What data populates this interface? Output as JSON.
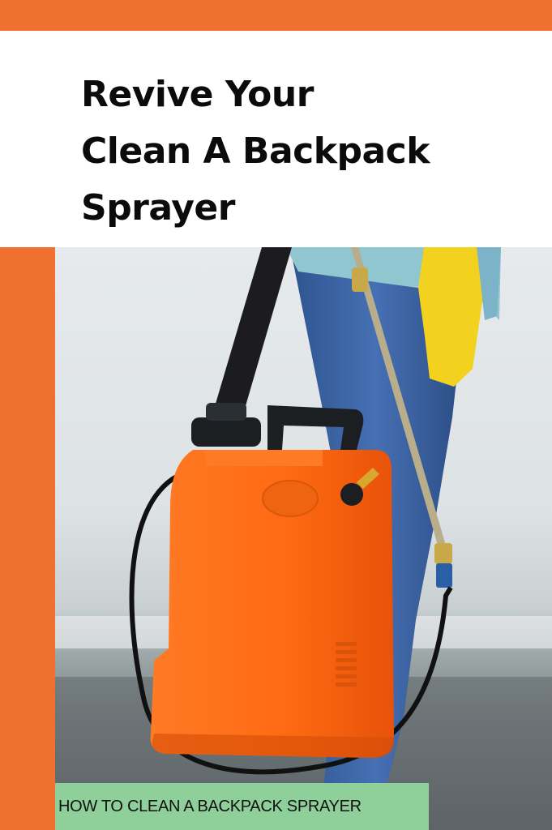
{
  "header": {
    "title_lines": [
      "Revive Your",
      "Clean A Backpack",
      "Sprayer"
    ]
  },
  "photo": {
    "subject": "sprayer-photo"
  },
  "caption": {
    "text": "HOW TO CLEAN A BACKPACK SPRAYER"
  },
  "colors": {
    "accent": "#f07030",
    "caption_bg": "#8fd09a",
    "tank": "#ff6a12",
    "jeans": "#3a62a8",
    "glove": "#f2d21e"
  }
}
